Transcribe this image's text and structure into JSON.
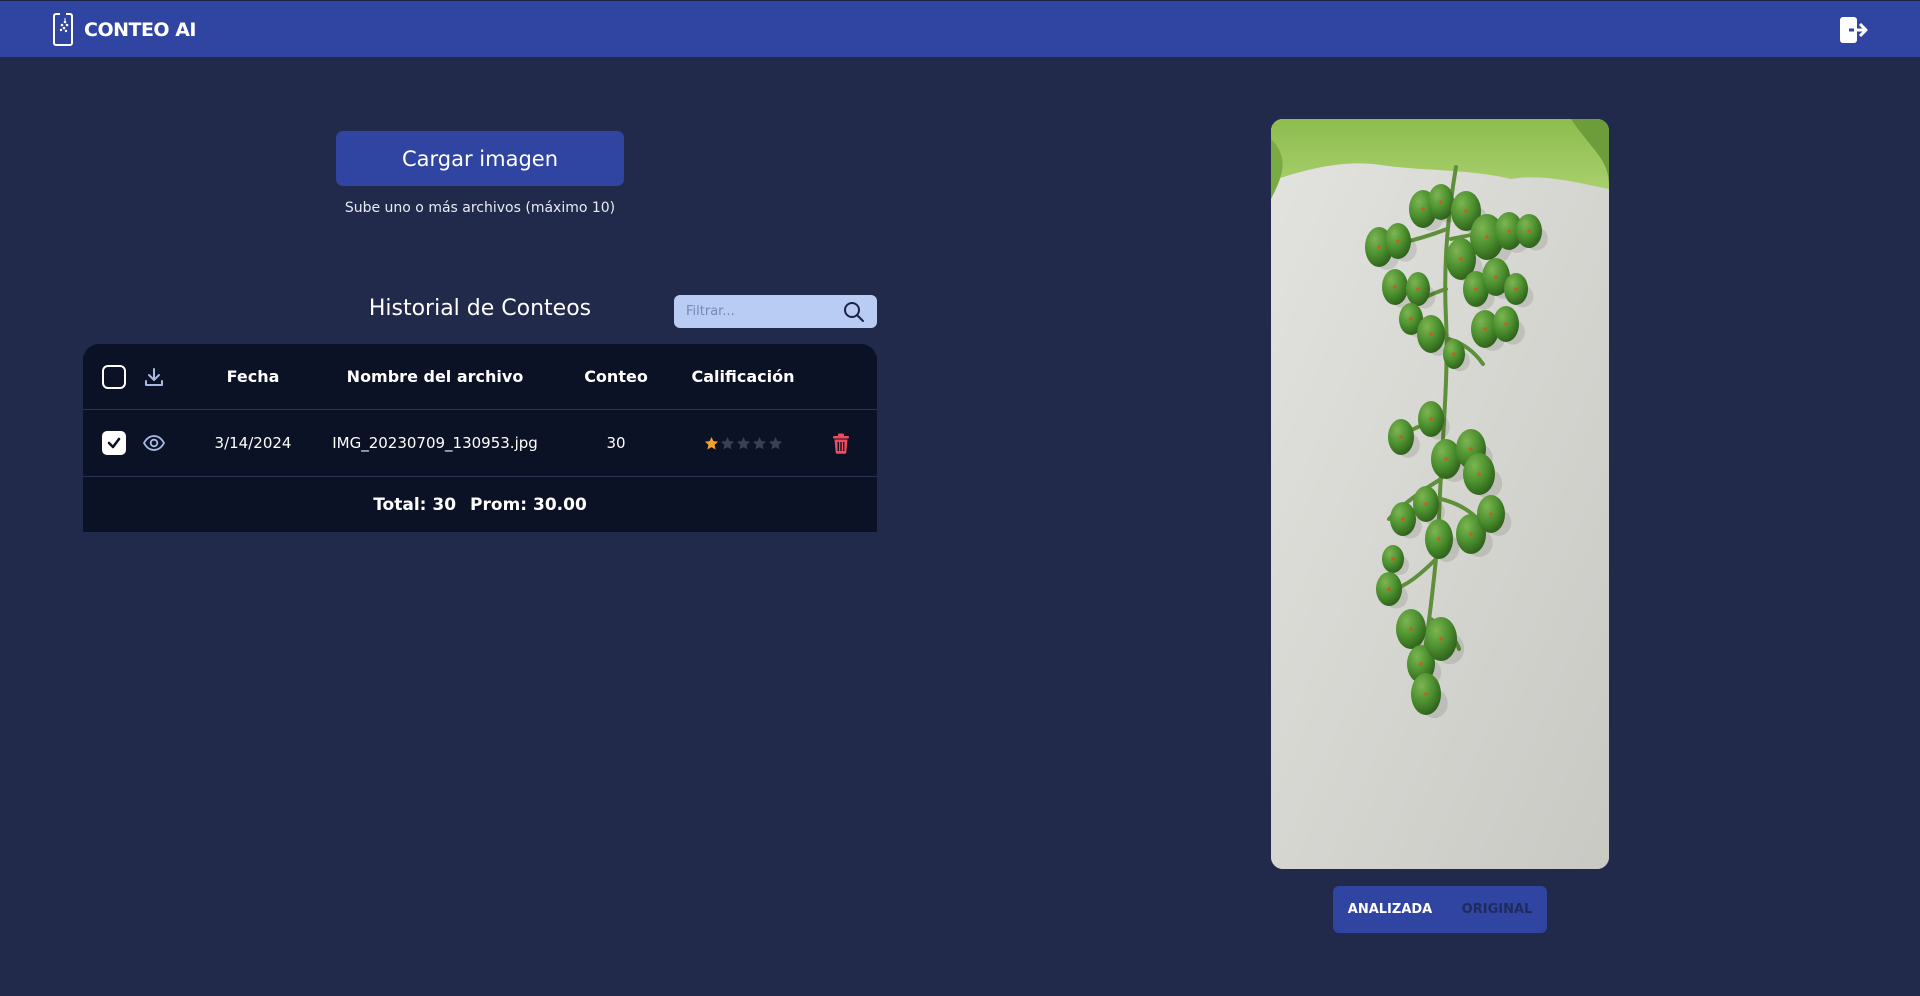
{
  "header": {
    "brand": "CONTEO AI",
    "brand_icon": "phone-grape-icon",
    "logout_icon": "logout-icon",
    "bar_color": "#3045a1"
  },
  "upload": {
    "button_label": "Cargar imagen",
    "hint": "Sube uno o más archivos (máximo 10)"
  },
  "history": {
    "title": "Historial de Conteos",
    "filter_placeholder": "Filtrar...",
    "filter_value": "",
    "columns": [
      "Fecha",
      "Nombre del archivo",
      "Conteo",
      "Calificación"
    ],
    "rows": [
      {
        "checked": true,
        "date": "3/14/2024",
        "filename": "IMG_20230709_130953.jpg",
        "count": "30",
        "rating": 1,
        "rating_max": 5
      }
    ],
    "footer": {
      "total": "Total: 30",
      "average": "Prom: 30.00"
    }
  },
  "preview": {
    "toggle": {
      "analyzed_label": "ANALIZADA",
      "original_label": "ORIGINAL",
      "selected": "ANALIZADA"
    }
  },
  "colors": {
    "background": "#212a4b",
    "accent": "#3045a1",
    "table_bg": "#0b1226",
    "star_filled": "#f0a030",
    "star_empty": "#3a3f52",
    "delete": "#ef4b5c"
  }
}
